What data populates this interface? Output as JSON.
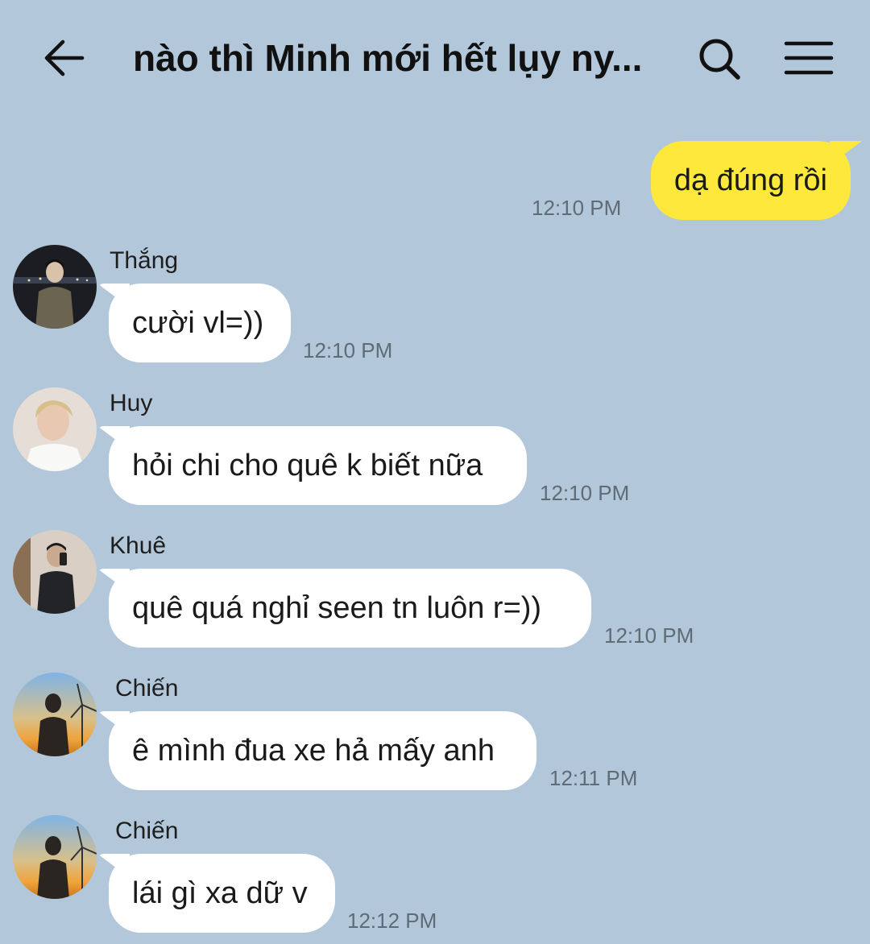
{
  "header": {
    "title": "nào thì Minh mới hết lụy ny...",
    "back_icon": "arrow-left-icon",
    "search_icon": "search-icon",
    "menu_icon": "hamburger-menu-icon"
  },
  "colors": {
    "background": "#b2c7da",
    "outgoing_bubble": "#fde83b",
    "incoming_bubble": "#ffffff",
    "timestamp": "#5f6b75"
  },
  "messages": [
    {
      "direction": "outgoing",
      "text": "dạ đúng rồi",
      "time": "12:10 PM"
    },
    {
      "direction": "incoming",
      "sender": "Thắng",
      "text": "cười vl=))",
      "time": "12:10 PM"
    },
    {
      "direction": "incoming",
      "sender": "Huy",
      "text": "hỏi chi cho quê k biết nữa",
      "time": "12:10 PM"
    },
    {
      "direction": "incoming",
      "sender": "Khuê",
      "text": "quê quá nghỉ seen tn luôn r=))",
      "time": "12:10 PM"
    },
    {
      "direction": "incoming",
      "sender": "Chiến",
      "text": "ê mình đua xe hả mấy anh",
      "time": "12:11 PM"
    },
    {
      "direction": "incoming",
      "sender": "Chiến",
      "text": "lái gì xa dữ v",
      "time": "12:12 PM"
    }
  ]
}
